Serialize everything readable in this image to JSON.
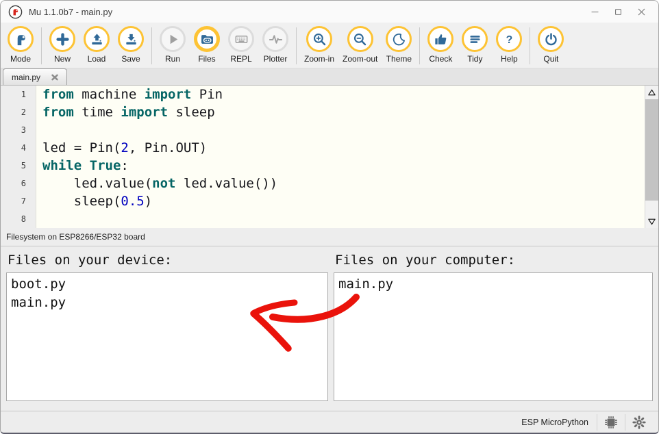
{
  "window": {
    "title": "Mu 1.1.0b7 - main.py",
    "logo_icon": "mu-logo-icon",
    "control_icons": [
      "minimize-icon",
      "maximize-icon",
      "close-icon"
    ]
  },
  "toolbar": {
    "buttons": [
      {
        "label": "Mode",
        "icon": "mode-icon",
        "state": "active",
        "sep_after": true
      },
      {
        "label": "New",
        "icon": "new-icon",
        "state": "active"
      },
      {
        "label": "Load",
        "icon": "load-icon",
        "state": "active"
      },
      {
        "label": "Save",
        "icon": "save-icon",
        "state": "active",
        "sep_after": true
      },
      {
        "label": "Run",
        "icon": "run-icon",
        "state": "disabled"
      },
      {
        "label": "Files",
        "icon": "files-icon",
        "state": "active",
        "checked": true
      },
      {
        "label": "REPL",
        "icon": "repl-icon",
        "state": "disabled"
      },
      {
        "label": "Plotter",
        "icon": "plotter-icon",
        "state": "disabled",
        "sep_after": true
      },
      {
        "label": "Zoom-in",
        "icon": "zoom-in-icon",
        "state": "active"
      },
      {
        "label": "Zoom-out",
        "icon": "zoom-out-icon",
        "state": "active"
      },
      {
        "label": "Theme",
        "icon": "theme-icon",
        "state": "active",
        "sep_after": true
      },
      {
        "label": "Check",
        "icon": "check-icon",
        "state": "active"
      },
      {
        "label": "Tidy",
        "icon": "tidy-icon",
        "state": "active"
      },
      {
        "label": "Help",
        "icon": "help-icon",
        "state": "active",
        "sep_after": true
      },
      {
        "label": "Quit",
        "icon": "quit-icon",
        "state": "active"
      }
    ]
  },
  "tab": {
    "label": "main.py",
    "close_icon": "tab-close-icon"
  },
  "editor": {
    "lines": [
      {
        "n": "1",
        "segs": [
          [
            "k",
            "from"
          ],
          [
            "p",
            " machine "
          ],
          [
            "k",
            "import"
          ],
          [
            "p",
            " Pin"
          ]
        ]
      },
      {
        "n": "2",
        "segs": [
          [
            "k",
            "from"
          ],
          [
            "p",
            " time "
          ],
          [
            "k",
            "import"
          ],
          [
            "p",
            " sleep"
          ]
        ]
      },
      {
        "n": "3",
        "segs": []
      },
      {
        "n": "4",
        "segs": [
          [
            "p",
            "led = Pin("
          ],
          [
            "n",
            "2"
          ],
          [
            "p",
            ", Pin.OUT)"
          ]
        ]
      },
      {
        "n": "5",
        "segs": [
          [
            "k",
            "while"
          ],
          [
            "p",
            " "
          ],
          [
            "k",
            "True"
          ],
          [
            "p",
            ":"
          ]
        ]
      },
      {
        "n": "6",
        "segs": [
          [
            "p",
            "    led.value("
          ],
          [
            "k",
            "not"
          ],
          [
            "p",
            " led.value())"
          ]
        ]
      },
      {
        "n": "7",
        "segs": [
          [
            "p",
            "    sleep("
          ],
          [
            "n",
            "0.5"
          ],
          [
            "p",
            ")"
          ]
        ]
      },
      {
        "n": "8",
        "segs": []
      }
    ],
    "scrollbar_icons": [
      "scroll-up-icon",
      "scroll-down-icon"
    ]
  },
  "filesystem": {
    "label": "Filesystem on ESP8266/ESP32 board",
    "device": {
      "heading": "Files on your device:",
      "files": [
        "boot.py",
        "main.py"
      ]
    },
    "computer": {
      "heading": "Files on your computer:",
      "files": [
        "main.py"
      ]
    }
  },
  "statusbar": {
    "mode_label": "ESP MicroPython",
    "icons": [
      "chip-icon",
      "gear-icon"
    ]
  },
  "colors": {
    "accent_yellow": "#fdc334",
    "brand_blue": "#306998",
    "keyword_teal": "#056565",
    "number_blue": "#0000bf",
    "editor_bg": "#fefef5",
    "arrow_red": "#ea130b"
  }
}
